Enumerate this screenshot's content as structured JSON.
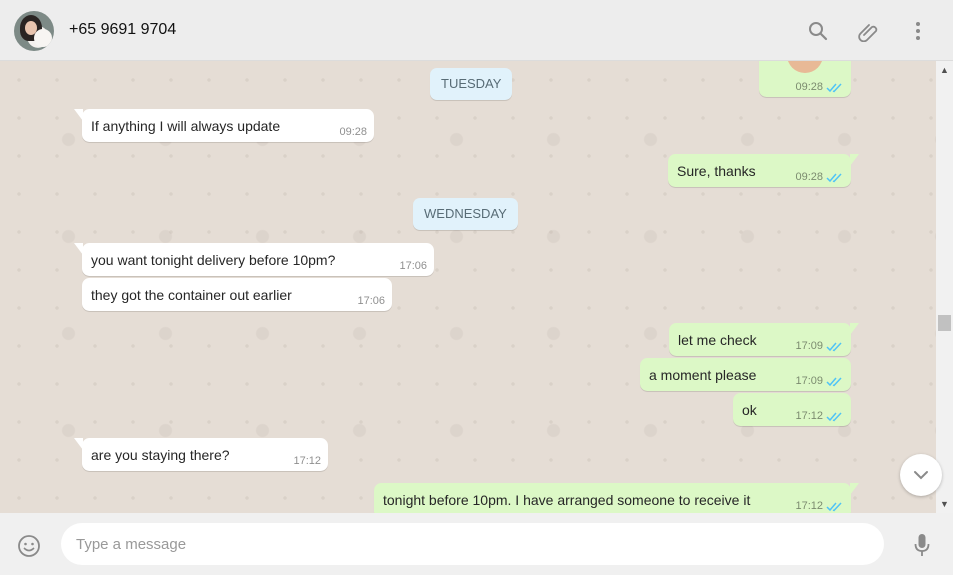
{
  "header": {
    "contact_name": "+65 9691 9704",
    "icons": [
      "search-icon",
      "attach-icon",
      "menu-icon"
    ]
  },
  "chat": {
    "date_separators": [
      "TUESDAY",
      "WEDNESDAY"
    ],
    "messages": [
      {
        "direction": "out",
        "text": "",
        "time": "09:28",
        "status": "read"
      },
      {
        "direction": "in",
        "text": "If anything I will always update",
        "time": "09:28"
      },
      {
        "direction": "out",
        "text": "Sure, thanks",
        "time": "09:28",
        "status": "read"
      },
      {
        "direction": "in",
        "text": "you want tonight delivery before 10pm?",
        "time": "17:06"
      },
      {
        "direction": "in",
        "text": "they got the container out earlier",
        "time": "17:06"
      },
      {
        "direction": "out",
        "text": "let me check",
        "time": "17:09",
        "status": "read"
      },
      {
        "direction": "out",
        "text": "a moment please",
        "time": "17:09",
        "status": "read"
      },
      {
        "direction": "out",
        "text": "ok",
        "time": "17:12",
        "status": "read"
      },
      {
        "direction": "in",
        "text": "are you staying there?",
        "time": "17:12"
      },
      {
        "direction": "out",
        "text": "tonight before 10pm. I have arranged someone to receive it",
        "time": "17:12",
        "status": "read"
      }
    ]
  },
  "composer": {
    "placeholder": "Type a message"
  },
  "colors": {
    "incoming": "#ffffff",
    "outgoing": "#dcf8c6",
    "read_ticks": "#4fc3f7",
    "wallpaper": "#e5ddd5"
  }
}
